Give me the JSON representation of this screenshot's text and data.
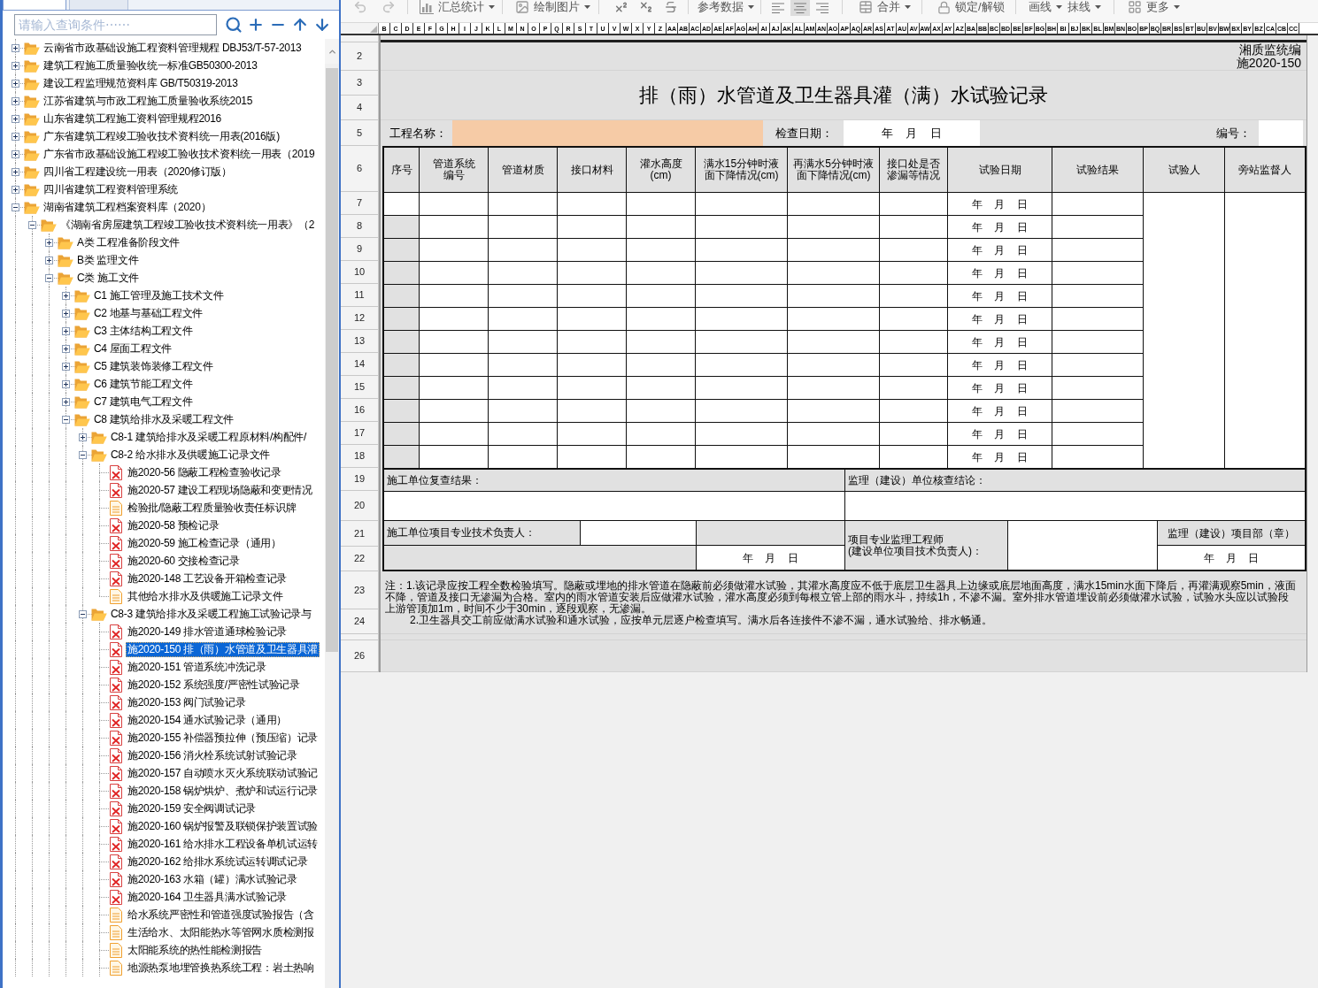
{
  "left_panel": {
    "tabs": [
      {
        "selected": true
      },
      {
        "selected": false
      }
    ],
    "search": {
      "placeholder": "请输入查询条件⋯⋯"
    },
    "tree": [
      {
        "label": "云南省市政基础设施工程资料管理规程 DBJ53/T-57-2013",
        "kind": "folder",
        "expanded": false,
        "selected": false
      },
      {
        "label": "建筑工程施工质量验收统一标准GB50300-2013",
        "kind": "folder",
        "expanded": false,
        "selected": false
      },
      {
        "label": "建设工程监理规范资料库 GB/T50319-2013",
        "kind": "folder",
        "expanded": false,
        "selected": false
      },
      {
        "label": "江苏省建筑与市政工程施工质量验收系统2015",
        "kind": "folder",
        "expanded": false,
        "selected": false
      },
      {
        "label": "山东省建筑工程施工资料管理规程2016",
        "kind": "folder",
        "expanded": false,
        "selected": false
      },
      {
        "label": "广东省建筑工程竣工验收技术资料统一用表(2016版)",
        "kind": "folder",
        "expanded": false,
        "selected": false
      },
      {
        "label": "广东省市政基础设施工程竣工验收技术资料统一用表（2019",
        "kind": "folder",
        "expanded": false,
        "selected": false
      },
      {
        "label": "四川省工程建设统一用表（2020修订版）",
        "kind": "folder",
        "expanded": false,
        "selected": false
      },
      {
        "label": "四川省建筑工程资料管理系统",
        "kind": "folder",
        "expanded": false,
        "selected": false
      },
      {
        "label": "湖南省建筑工程档案资料库（2020）",
        "kind": "folder",
        "expanded": true,
        "selected": false,
        "children": [
          {
            "label": "《湖南省房屋建筑工程竣工验收技术资料统一用表》（2",
            "kind": "folder",
            "expanded": true,
            "selected": false,
            "children": [
              {
                "label": "A类 工程准备阶段文件",
                "kind": "folder",
                "expanded": false,
                "selected": false
              },
              {
                "label": "B类 监理文件",
                "kind": "folder",
                "expanded": false,
                "selected": false
              },
              {
                "label": "C类 施工文件",
                "kind": "folder",
                "expanded": true,
                "selected": false,
                "children": [
                  {
                    "label": "C1 施工管理及施工技术文件",
                    "kind": "folder",
                    "expanded": false,
                    "selected": false
                  },
                  {
                    "label": "C2 地基与基础工程文件",
                    "kind": "folder",
                    "expanded": false,
                    "selected": false
                  },
                  {
                    "label": "C3 主体结构工程文件",
                    "kind": "folder",
                    "expanded": false,
                    "selected": false
                  },
                  {
                    "label": "C4 屋面工程文件",
                    "kind": "folder",
                    "expanded": false,
                    "selected": false
                  },
                  {
                    "label": "C5 建筑装饰装修工程文件",
                    "kind": "folder",
                    "expanded": false,
                    "selected": false
                  },
                  {
                    "label": "C6 建筑节能工程文件",
                    "kind": "folder",
                    "expanded": false,
                    "selected": false
                  },
                  {
                    "label": "C7 建筑电气工程文件",
                    "kind": "folder",
                    "expanded": false,
                    "selected": false
                  },
                  {
                    "label": "C8 建筑给排水及采暖工程文件",
                    "kind": "folder",
                    "expanded": true,
                    "selected": false,
                    "children": [
                      {
                        "label": "C8-1 建筑给排水及采暖工程原材料/构配件/",
                        "kind": "folder",
                        "expanded": false,
                        "selected": false
                      },
                      {
                        "label": "C8-2 给水排水及供暖施工记录文件",
                        "kind": "folder",
                        "expanded": true,
                        "selected": false,
                        "children": [
                          {
                            "label": "施2020-56 隐蔽工程检查验收记录",
                            "kind": "form",
                            "selected": false
                          },
                          {
                            "label": "施2020-57 建设工程现场隐蔽和变更情况",
                            "kind": "form",
                            "selected": false
                          },
                          {
                            "label": "检验批/隐蔽工程质量验收责任标识牌",
                            "kind": "document",
                            "selected": false
                          },
                          {
                            "label": "施2020-58 预检记录",
                            "kind": "form",
                            "selected": false
                          },
                          {
                            "label": "施2020-59 施工检查记录（通用）",
                            "kind": "form",
                            "selected": false
                          },
                          {
                            "label": "施2020-60 交接检查记录",
                            "kind": "form",
                            "selected": false
                          },
                          {
                            "label": "施2020-148 工艺设备开箱检查记录",
                            "kind": "form",
                            "selected": false
                          },
                          {
                            "label": "其他给水排水及供暖施工记录文件",
                            "kind": "document",
                            "selected": false
                          }
                        ]
                      },
                      {
                        "label": "C8-3 建筑给排水及采暖工程施工试验记录与",
                        "kind": "folder",
                        "expanded": true,
                        "selected": false,
                        "children": [
                          {
                            "label": "施2020-149 排水管道通球检验记录",
                            "kind": "form",
                            "selected": false
                          },
                          {
                            "label": "施2020-150 排（雨）水管道及卫生器具灌",
                            "kind": "form",
                            "selected": true
                          },
                          {
                            "label": "施2020-151 管道系统冲洗记录",
                            "kind": "form",
                            "selected": false
                          },
                          {
                            "label": "施2020-152 系统强度/严密性试验记录",
                            "kind": "form",
                            "selected": false
                          },
                          {
                            "label": "施2020-153 阀门试验记录",
                            "kind": "form",
                            "selected": false
                          },
                          {
                            "label": "施2020-154 通水试验记录（通用）",
                            "kind": "form",
                            "selected": false
                          },
                          {
                            "label": "施2020-155 补偿器预拉伸（预压缩）记录",
                            "kind": "form",
                            "selected": false
                          },
                          {
                            "label": "施2020-156 消火栓系统试射试验记录",
                            "kind": "form",
                            "selected": false
                          },
                          {
                            "label": "施2020-157 自动喷水灭火系统联动试验记",
                            "kind": "form",
                            "selected": false
                          },
                          {
                            "label": "施2020-158 锅炉烘炉、煮炉和试运行记录",
                            "kind": "form",
                            "selected": false
                          },
                          {
                            "label": "施2020-159 安全阀调试记录",
                            "kind": "form",
                            "selected": false
                          },
                          {
                            "label": "施2020-160 锅炉报警及联锁保护装置试验",
                            "kind": "form",
                            "selected": false
                          },
                          {
                            "label": "施2020-161 给水排水工程设备单机试运转",
                            "kind": "form",
                            "selected": false
                          },
                          {
                            "label": "施2020-162 给排水系统试运转调试记录",
                            "kind": "form",
                            "selected": false
                          },
                          {
                            "label": "施2020-163 水箱（罐）满水试验记录",
                            "kind": "form",
                            "selected": false
                          },
                          {
                            "label": "施2020-164 卫生器具满水试验记录",
                            "kind": "form",
                            "selected": false
                          },
                          {
                            "label": "给水系统严密性和管道强度试验报告（含",
                            "kind": "document",
                            "selected": false
                          },
                          {
                            "label": "生活给水、太阳能热水等管网水质检测报",
                            "kind": "document",
                            "selected": false
                          },
                          {
                            "label": "太阳能系统的热性能检测报告",
                            "kind": "document",
                            "selected": false
                          },
                          {
                            "label": "地源热泵地埋管换热系统工程：岩土热响",
                            "kind": "document",
                            "selected": false
                          }
                        ]
                      }
                    ]
                  }
                ]
              }
            ]
          }
        ]
      }
    ]
  },
  "toolbar": {
    "undo": {
      "disabled": true
    },
    "redo": {
      "disabled": true
    },
    "summary_button": {
      "label": "汇总统计"
    },
    "picture_button": {
      "label": "绘制图片"
    },
    "reference_button": {
      "label": "参考数据"
    },
    "alignment": [
      {
        "selected": false
      },
      {
        "selected": true
      },
      {
        "selected": false
      }
    ],
    "merge_button": {
      "label": "合并"
    },
    "lock_button": {
      "label": "锁定/解锁"
    },
    "draw_line_button": {
      "label": "画线"
    },
    "erase_line_button": {
      "label": "抹线"
    },
    "more_button": {
      "label": "更多"
    }
  },
  "sheet": {
    "column_headers": [
      "B",
      "C",
      "D",
      "E",
      "F",
      "G",
      "H",
      "I",
      "J",
      "K",
      "L",
      "M",
      "N",
      "O",
      "P",
      "Q",
      "R",
      "S",
      "T",
      "U",
      "V",
      "W",
      "X",
      "Y",
      "Z",
      "AA",
      "AB",
      "AC",
      "AD",
      "AE",
      "AF",
      "AG",
      "AH",
      "AI",
      "AJ",
      "AK",
      "AL",
      "AM",
      "AN",
      "AO",
      "AP",
      "AQ",
      "AR",
      "AS",
      "AT",
      "AU",
      "AV",
      "AW",
      "AX",
      "AY",
      "AZ",
      "BA",
      "BB",
      "BC",
      "BD",
      "BE",
      "BF",
      "BG",
      "BH",
      "BI",
      "BJ",
      "BK",
      "BL",
      "BM",
      "BN",
      "BO",
      "BP",
      "BQ",
      "BR",
      "BS",
      "BT",
      "BU",
      "BV",
      "BW",
      "BX",
      "BY",
      "BZ",
      "CA",
      "CB",
      "CC"
    ],
    "row_numbers": [
      "2",
      "3",
      "4",
      "5",
      "6",
      "7",
      "8",
      "9",
      "10",
      "11",
      "12",
      "13",
      "14",
      "15",
      "16",
      "17",
      "18",
      "19",
      "20",
      "21",
      "22",
      "23",
      "24",
      "26"
    ],
    "form_code": [
      "湘质监统编",
      "施2020-150"
    ],
    "title": "排（雨）水管道及卫生器具灌（满）水试验记录",
    "project_name_label": "工程名称：",
    "inspection_date_label": "检查日期：",
    "inspection_date": "年    月    日",
    "number_label": "编号：",
    "table": {
      "columns": [
        "序号",
        "管道系统编号",
        "管道材质",
        "接口材料",
        "灌水高度(cm)",
        "满水15分钟时液面下降情况(cm)",
        "再满水5分钟时液面下降情况(cm)",
        "接口处是否渗漏等情况",
        "试验日期",
        "试验结果",
        "试验人",
        "旁站监督人"
      ],
      "rows": [
        {
          "shaded": false,
          "test_date": "年    月    日"
        },
        {
          "shaded": true,
          "test_date": "年    月    日"
        },
        {
          "shaded": true,
          "test_date": "年    月    日"
        },
        {
          "shaded": true,
          "test_date": "年    月    日"
        },
        {
          "shaded": true,
          "test_date": "年    月    日"
        },
        {
          "shaded": true,
          "test_date": "年    月    日"
        },
        {
          "shaded": true,
          "test_date": "年    月    日"
        },
        {
          "shaded": true,
          "test_date": "年    月    日"
        },
        {
          "shaded": true,
          "test_date": "年    月    日"
        },
        {
          "shaded": true,
          "test_date": "年    月    日"
        },
        {
          "shaded": true,
          "test_date": "年    月    日"
        },
        {
          "shaded": true,
          "test_date": "年    月    日"
        }
      ]
    },
    "signoff": {
      "contractor_review_label": "施工单位复查结果：",
      "supervisor_review_label": "监理（建设）单位核查结论：",
      "contractor_tech_lead_label": "施工单位项目专业技术负责人：",
      "contractor_date": "年    月    日",
      "supervising_engineer_label": "项目专业监理工程师\n(建设单位项目技术负责人)：",
      "supervisor_dept_label": "监理（建设）项目部（章）",
      "supervisor_date": "年    月    日"
    },
    "notes": [
      "注：1.该记录应按工程全数检验填写。隐蔽或埋地的排水管道在隐蔽前必须做灌水试验，其灌水高度应不低于底层卫生器具上边缘或底层地面高度，满水15min水面下降后，再灌满观察5min，液面不降，管道及接口无渗漏为合格。室内的雨水管道安装后应做灌水试验，灌水高度必须到每根立管上部的雨水斗，持续1h，不渗不漏。室外排水管道埋设前必须做灌水试验，试验水头应以试验段上游管顶加1m，时间不少于30min，逐段观察，无渗漏。",
      "2.卫生器具交工前应做满水试验和通水试验，应按单元层逐户检查填写。满水后各连接件不渗不漏，通水试验给、排水畅通。"
    ]
  }
}
